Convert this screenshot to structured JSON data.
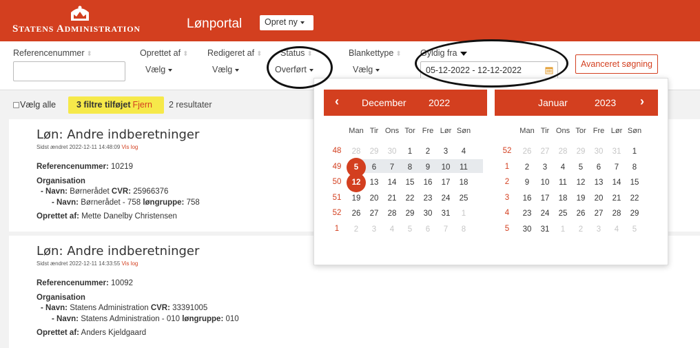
{
  "header": {
    "logo_text_big1": "S",
    "logo_text_small1": "TATENS ",
    "logo_text_big2": "A",
    "logo_text_small2": "DMINISTRATION",
    "app_title": "Lønportal",
    "create_button": "Opret ny"
  },
  "filters": {
    "reference_label": "Referencenummer",
    "created_by_label": "Oprettet af",
    "created_by_value": "Vælg",
    "edited_by_label": "Redigeret af",
    "edited_by_value": "Vælg",
    "status_label": "Status",
    "status_value": "Overført",
    "form_type_label": "Blankettype",
    "form_type_value": "Vælg",
    "valid_from_label": "Gyldig fra",
    "date_range_value": "05-12-2022 - 12-12-2022",
    "advanced_search": "Avanceret søgning"
  },
  "results_bar": {
    "select_all": "Vælg alle",
    "filters_added": "3 filtre tilføjet",
    "remove": "Fjern",
    "results_count": "2 resultater"
  },
  "cards": [
    {
      "title": "Løn: Andre indberetninger",
      "meta": "Sidst ændret 2022-12-11 14:48:09",
      "log": "Vis log",
      "ref_label": "Referencenummer:",
      "ref_value": "10219",
      "org_label": "Organisation",
      "line1_label": "- Navn:",
      "line1_value": "Børnerådet",
      "line1_cvr_label": "CVR:",
      "line1_cvr_value": "25966376",
      "line2_label": "- Navn:",
      "line2_value": "Børnerådet - 758",
      "line2_group_label": "løngruppe:",
      "line2_group_value": "758",
      "creator_label": "Oprettet af:",
      "creator_value": "Mette Danelby Christensen"
    },
    {
      "title": "Løn: Andre indberetninger",
      "meta": "Sidst ændret 2022-12-11 14:33:55",
      "log": "Vis log",
      "ref_label": "Referencenummer:",
      "ref_value": "10092",
      "org_label": "Organisation",
      "line1_label": "- Navn:",
      "line1_value": "Statens Administration",
      "line1_cvr_label": "CVR:",
      "line1_cvr_value": "33391005",
      "line2_label": "- Navn:",
      "line2_value": "Statens Administration - 010",
      "line2_group_label": "løngruppe:",
      "line2_group_value": "010",
      "creator_label": "Oprettet af:",
      "creator_value": "Anders Kjeldgaard"
    }
  ],
  "datepicker": {
    "day_names": [
      "Man",
      "Tir",
      "Ons",
      "Tor",
      "Fre",
      "Lør",
      "Søn"
    ],
    "months": [
      {
        "month": "December",
        "year": "2022",
        "weeks": [
          "48",
          "49",
          "50",
          "51",
          "52",
          "1"
        ],
        "days": [
          [
            "28",
            "29",
            "30",
            "1",
            "2",
            "3",
            "4"
          ],
          [
            "5",
            "6",
            "7",
            "8",
            "9",
            "10",
            "11"
          ],
          [
            "12",
            "13",
            "14",
            "15",
            "16",
            "17",
            "18"
          ],
          [
            "19",
            "20",
            "21",
            "22",
            "23",
            "24",
            "25"
          ],
          [
            "26",
            "27",
            "28",
            "29",
            "30",
            "31",
            "1"
          ],
          [
            "2",
            "3",
            "4",
            "5",
            "6",
            "7",
            "8"
          ]
        ],
        "muted": [
          [
            0,
            0
          ],
          [
            0,
            1
          ],
          [
            0,
            2
          ],
          [
            4,
            6
          ],
          [
            5,
            0
          ],
          [
            5,
            1
          ],
          [
            5,
            2
          ],
          [
            5,
            3
          ],
          [
            5,
            4
          ],
          [
            5,
            5
          ],
          [
            5,
            6
          ]
        ]
      },
      {
        "month": "Januar",
        "year": "2023",
        "weeks": [
          "52",
          "1",
          "2",
          "3",
          "4",
          "5"
        ],
        "days": [
          [
            "26",
            "27",
            "28",
            "29",
            "30",
            "31",
            "1"
          ],
          [
            "2",
            "3",
            "4",
            "5",
            "6",
            "7",
            "8"
          ],
          [
            "9",
            "10",
            "11",
            "12",
            "13",
            "14",
            "15"
          ],
          [
            "16",
            "17",
            "18",
            "19",
            "20",
            "21",
            "22"
          ],
          [
            "23",
            "24",
            "25",
            "26",
            "27",
            "28",
            "29"
          ],
          [
            "30",
            "31",
            "1",
            "2",
            "3",
            "4",
            "5"
          ]
        ],
        "muted": [
          [
            0,
            0
          ],
          [
            0,
            1
          ],
          [
            0,
            2
          ],
          [
            0,
            3
          ],
          [
            0,
            4
          ],
          [
            0,
            5
          ],
          [
            5,
            2
          ],
          [
            5,
            3
          ],
          [
            5,
            4
          ],
          [
            5,
            5
          ],
          [
            5,
            6
          ]
        ]
      }
    ],
    "range_start": "5",
    "range_end": "12"
  },
  "colors": {
    "brand": "#d33f1f",
    "highlight": "#f6e94a",
    "range": "#e7eaed"
  }
}
